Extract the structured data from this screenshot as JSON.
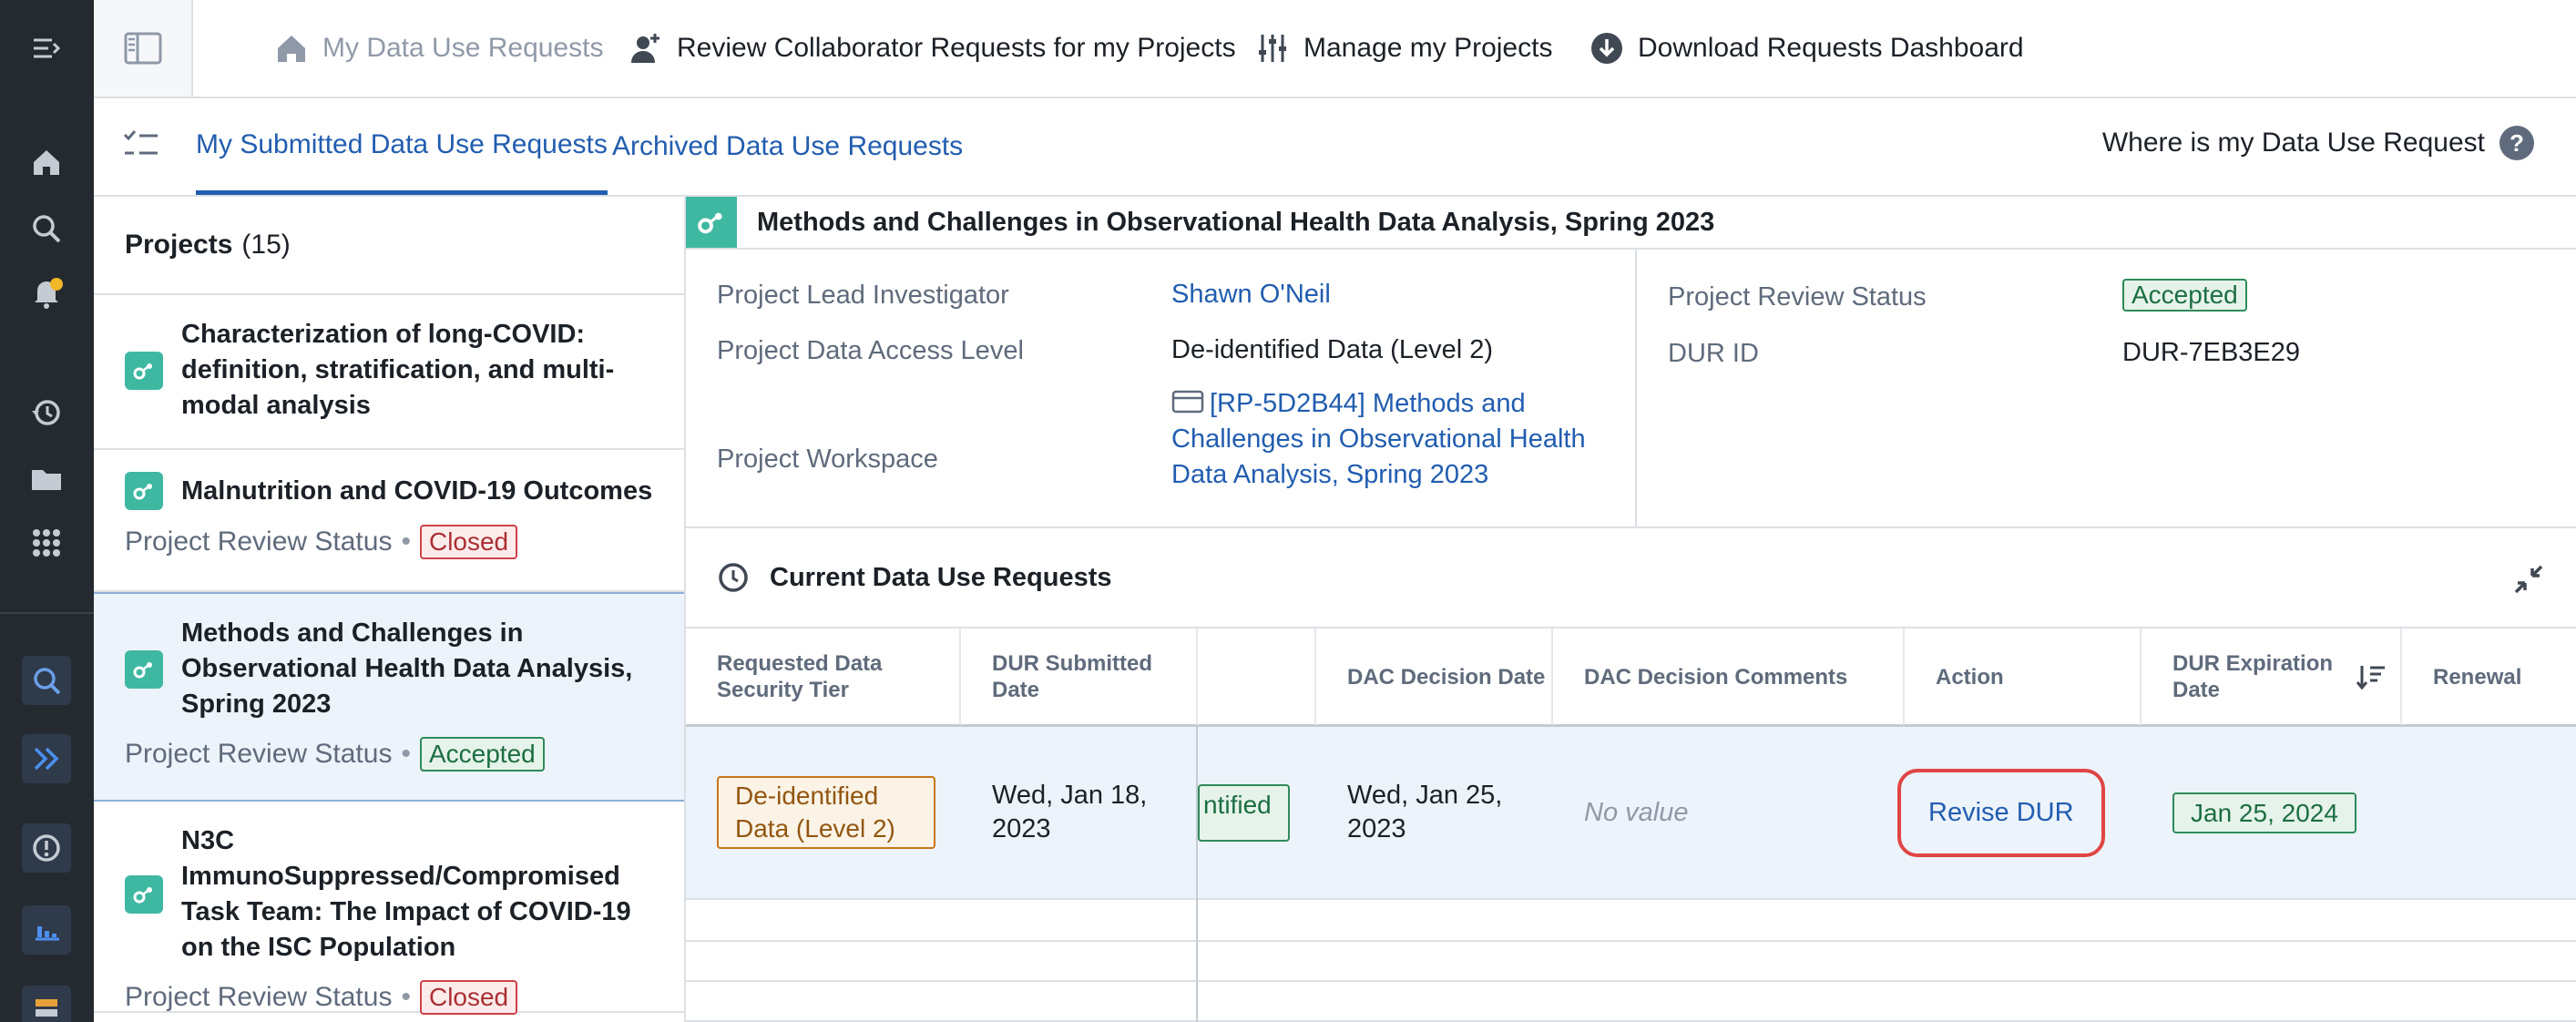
{
  "colors": {
    "rail_bg": "#252a31",
    "accent_blue": "#215db0",
    "project_icon": "#3fb8a2",
    "closed_red": "#cd4246",
    "accepted_green": "#2d8a5a",
    "tier_orange": "#c87619",
    "highlight_ring": "#e04545"
  },
  "rail": {
    "icons": [
      "menu-collapse-icon",
      "home-icon",
      "search-icon",
      "notifications-icon",
      "history-icon",
      "folder-icon",
      "apps-grid-icon",
      "search-app-icon",
      "chevron-double-right-icon",
      "error-icon",
      "chart-icon",
      "table-icon"
    ]
  },
  "topnav": {
    "items": [
      {
        "label": "My Data Use Requests",
        "icon": "home-icon"
      },
      {
        "label": "Review Collaborator Requests for my Projects",
        "icon": "user-add-icon"
      },
      {
        "label": "Manage my Projects",
        "icon": "sliders-icon"
      },
      {
        "label": "Download Requests Dashboard",
        "icon": "download-icon"
      }
    ]
  },
  "tabs": {
    "submitted": "My Submitted Data Use Requests",
    "archived": "Archived Data Use Requests",
    "help": "Where is my Data Use Request",
    "help_icon": "?"
  },
  "projects": {
    "title": "Projects",
    "count": "(15)",
    "items": [
      {
        "name": "Characterization of long-COVID: definition, stratification, and multi-modal analysis",
        "status_label": "",
        "status": ""
      },
      {
        "name": "Malnutrition and COVID-19 Outcomes",
        "status_label": "Project Review Status",
        "status": "Closed"
      },
      {
        "name": "Methods and Challenges in Observational Health Data Analysis, Spring 2023",
        "status_label": "Project Review Status",
        "status": "Accepted"
      },
      {
        "name": "N3C ImmunoSuppressed/Compromised Task Team: The Impact of COVID-19 on the ISC Population",
        "status_label": "Project Review Status",
        "status": "Closed"
      }
    ],
    "separator": "•"
  },
  "detail": {
    "title": "Methods and Challenges in Observational Health Data Analysis, Spring 2023",
    "lead_label": "Project Lead Investigator",
    "lead_value": "Shawn O'Neil",
    "access_label": "Project Data Access Level",
    "access_value": "De-identified Data (Level 2)",
    "workspace_label": "Project Workspace",
    "workspace_value": "[RP-5D2B44] Methods and Challenges in Observational Health Data Analysis, Spring 2023",
    "review_status_label": "Project Review Status",
    "review_status_value": "Accepted",
    "dur_id_label": "DUR ID",
    "dur_id_value": "DUR-7EB3E29"
  },
  "current_dur": {
    "title": "Current Data Use Requests",
    "columns": [
      "Requested Data Security Tier",
      "DUR Submitted Date",
      "DAC Decision Date",
      "DAC Decision Comments",
      "Action",
      "DUR Expiration Date",
      "Renewal"
    ],
    "row": {
      "tier": "De-identified Data (Level 2)",
      "submitted": "Wed, Jan 18, 2023",
      "partial_tag": "ntified",
      "dac_date": "Wed, Jan 25, 2023",
      "comments": "No value",
      "action": "Revise DUR",
      "expiration": "Jan 25, 2024",
      "renewal": ""
    }
  }
}
